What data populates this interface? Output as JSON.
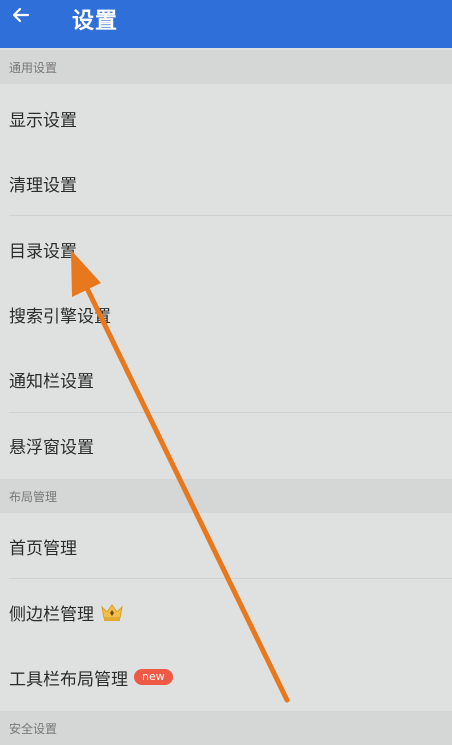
{
  "header": {
    "back_icon": "arrow-left-icon",
    "title": "设置",
    "accent_color": "#2f6fd9"
  },
  "sections": [
    {
      "title": "通用设置",
      "items": [
        {
          "label": "显示设置"
        },
        {
          "label": "清理设置"
        },
        {
          "label": "目录设置"
        },
        {
          "label": "搜索引擎设置"
        },
        {
          "label": "通知栏设置"
        },
        {
          "label": "悬浮窗设置"
        }
      ]
    },
    {
      "title": "布局管理",
      "items": [
        {
          "label": "首页管理"
        },
        {
          "label": "侧边栏管理",
          "icon": "crown-icon"
        },
        {
          "label": "工具栏布局管理",
          "badge": "new",
          "badge_color": "#ef5a47"
        }
      ]
    },
    {
      "title": "安全设置",
      "items": []
    }
  ],
  "annotation": {
    "icon": "annotation-arrow-icon",
    "color": "#e8781e"
  }
}
